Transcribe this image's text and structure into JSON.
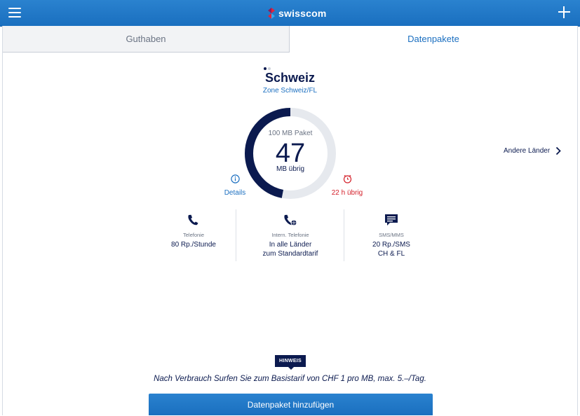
{
  "header": {
    "brand": "swisscom",
    "icons": {
      "menu": "menu-icon",
      "add": "plus-icon",
      "logo": "swisscom-logo-icon"
    },
    "colors": {
      "bar": "#1f78c8",
      "text": "#ffffff"
    }
  },
  "tabs": [
    {
      "label": "Guthaben",
      "active": false
    },
    {
      "label": "Datenpakete",
      "active": true
    }
  ],
  "pager": {
    "count": 2,
    "current": 1
  },
  "package": {
    "country": "Schweiz",
    "zone": "Zone Schweiz/FL",
    "size_label": "100 MB Paket",
    "remaining_value": "47",
    "remaining_unit": "MB übrig",
    "remaining_fraction": 0.47,
    "details_label": "Details",
    "time_left": "22 h übrig",
    "colors": {
      "ring": "#0b1a4f",
      "ring_bg": "#e6e9ee",
      "alert": "#d4202a",
      "link": "#1b6fc0"
    }
  },
  "other_countries": {
    "label": "Andere Länder",
    "icon": "chevron-right-icon"
  },
  "features": [
    {
      "icon": "phone-icon",
      "title": "Telefonie",
      "lines": [
        "80 Rp./Stunde"
      ]
    },
    {
      "icon": "intl-phone-icon",
      "title": "Intern. Telefonie",
      "lines": [
        "In alle Länder",
        "zum Standardtarif"
      ]
    },
    {
      "icon": "sms-icon",
      "title": "SMS/MMS",
      "lines": [
        "20 Rp./SMS",
        "CH & FL"
      ]
    }
  ],
  "hint": {
    "badge": "HINWEIS",
    "text": "Nach Verbrauch Surfen Sie zum Basistarif von CHF 1 pro MB, max. 5.–/Tag."
  },
  "cta": {
    "label": "Datenpaket hinzufügen"
  }
}
